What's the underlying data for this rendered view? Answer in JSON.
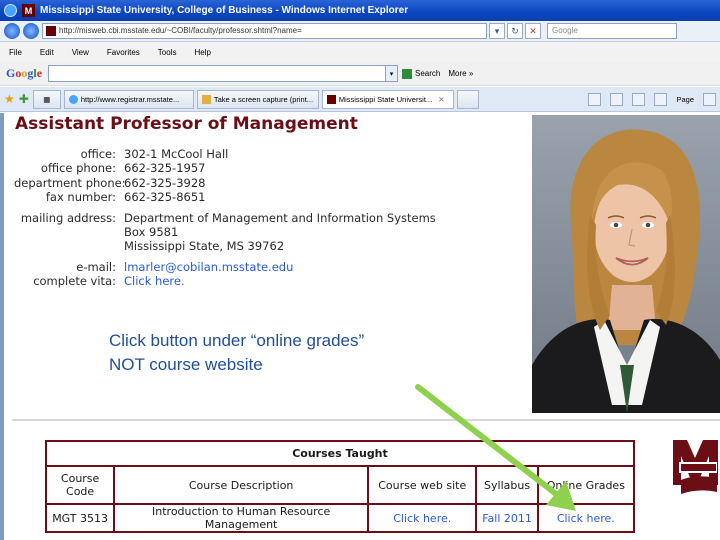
{
  "browser": {
    "window_title": "Mississippi State University, College of Business - Windows Internet Explorer",
    "address": "http://misweb.cbi.msstate.edu/~COBI/faculty/professor.shtml?name=",
    "search_placeholder": "Google",
    "menu": [
      "File",
      "Edit",
      "View",
      "Favorites",
      "Tools",
      "Help"
    ],
    "google_search_label": "Search",
    "google_more_label": "More »",
    "tabs": [
      {
        "label": "http://www.registrar.msstate..."
      },
      {
        "label": "Take a screen capture (print..."
      },
      {
        "label": "Mississippi State Universit..."
      }
    ],
    "tools_page": "Page"
  },
  "page": {
    "heading": "Assistant Professor of Management",
    "contact": [
      {
        "label": "office:",
        "value": "302-1 McCool Hall"
      },
      {
        "label": "office phone:",
        "value": "662-325-1957"
      },
      {
        "label": "department phone:",
        "value": "662-325-3928"
      },
      {
        "label": "fax number:",
        "value": "662-325-8651"
      }
    ],
    "mailing_label": "mailing address:",
    "mailing_lines": [
      "Department of Management and Information Systems",
      "Box 9581",
      "Mississippi State, MS 39762"
    ],
    "email_label": "e-mail:",
    "email_value": "lmarler@cobilan.msstate.edu",
    "vita_label": "complete vita:",
    "vita_value": "Click here."
  },
  "callout": {
    "line1": "Click button under “online grades”",
    "line2": "NOT course website"
  },
  "courses": {
    "caption": "Courses Taught",
    "headers": [
      "Course Code",
      "Course Description",
      "Course web site",
      "Syllabus",
      "Online Grades"
    ],
    "rows": [
      {
        "code": "MGT 3513",
        "description": "Introduction to Human Resource Management",
        "website": "Click here.",
        "syllabus": "Fall 2011",
        "grades": "Click here."
      }
    ]
  },
  "colors": {
    "maroon": "#6b0e15",
    "link_blue": "#2a5ad8",
    "callout_blue": "#1f4e9a",
    "arrow_green": "#8fd14f"
  }
}
